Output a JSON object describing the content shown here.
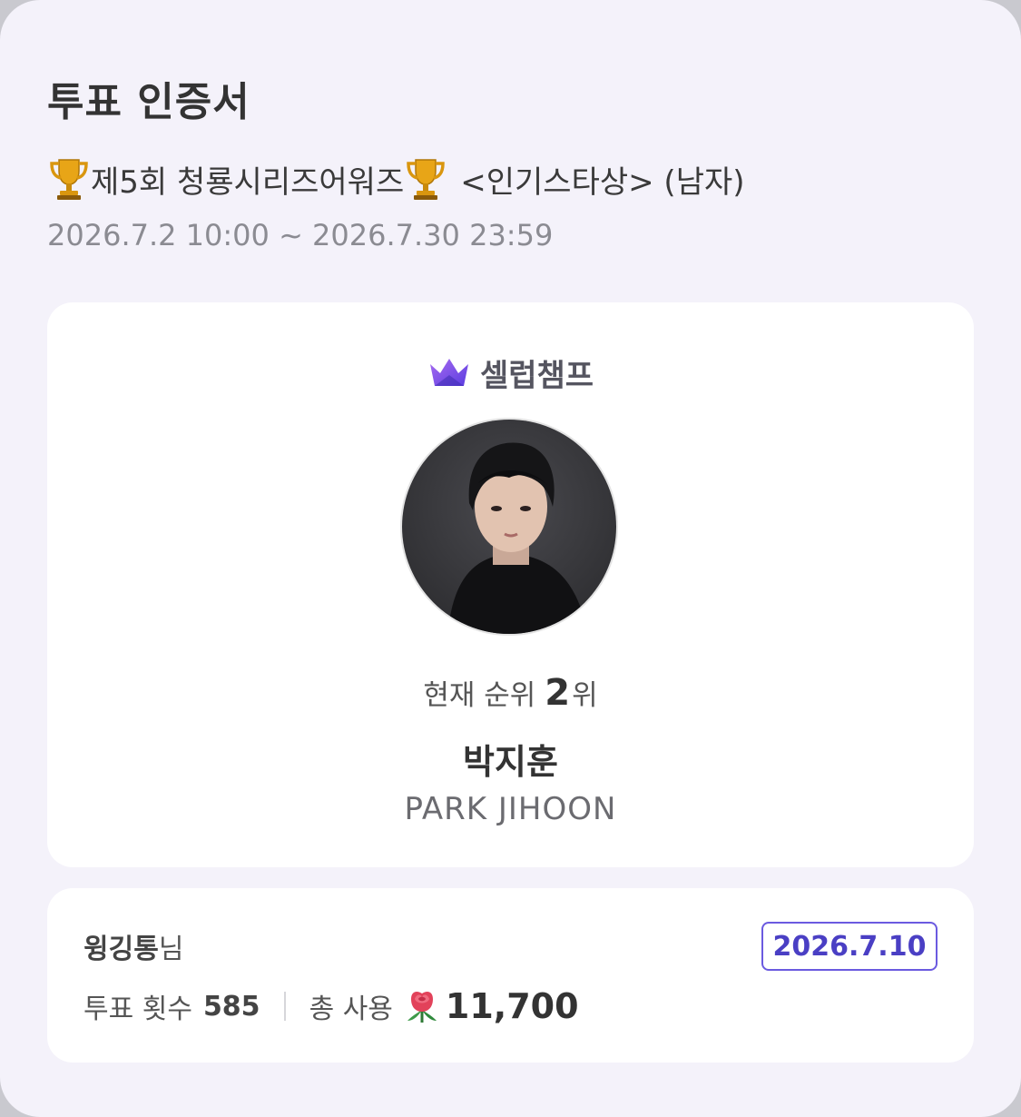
{
  "certificate": {
    "title": "투표 인증서",
    "event_name": "제5회 청룡시리즈어워즈",
    "event_category": "<인기스타상> (남자)",
    "event_period": "2026.7.2 10:00 ~ 2026.7.30 23:59"
  },
  "celeb": {
    "brand": "셀럽챔프",
    "rank_label": "현재 순위",
    "rank_value": "2",
    "rank_suffix": "위",
    "name_ko": "박지훈",
    "name_en": "PARK JIHOON"
  },
  "user": {
    "nickname": "윙깅통",
    "honorific": "님",
    "date": "2026.7.10",
    "vote_count_label": "투표 횟수",
    "vote_count": "585",
    "total_used_label": "총 사용",
    "total_used": "11,700"
  },
  "colors": {
    "accent": "#6b5ae0",
    "background": "#f4f2fa",
    "card": "#ffffff"
  },
  "icons": [
    "trophy-icon",
    "crown-icon",
    "rose-icon"
  ]
}
